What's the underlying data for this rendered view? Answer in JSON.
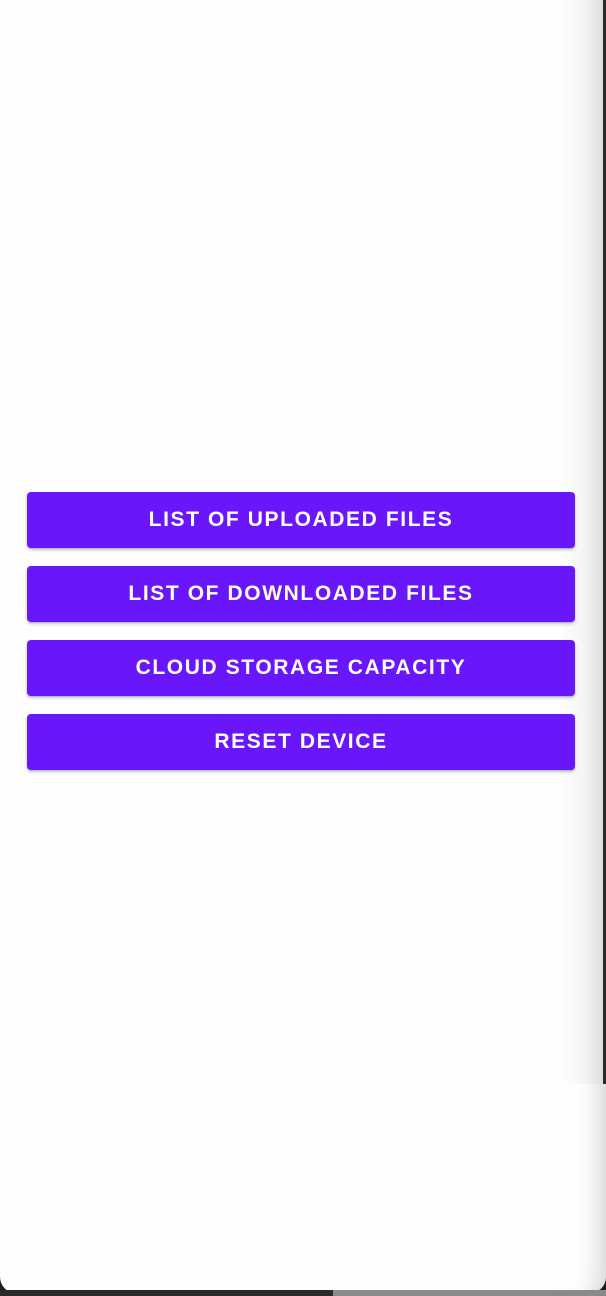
{
  "menu": {
    "buttons": [
      {
        "label": "LIST OF UPLOADED FILES"
      },
      {
        "label": "LIST OF DOWNLOADED FILES"
      },
      {
        "label": "CLOUD STORAGE CAPACITY"
      },
      {
        "label": "RESET DEVICE"
      }
    ]
  },
  "theme": {
    "button_color": "#6a16fb",
    "button_text_color": "#ffffff",
    "background_color": "#fefefe"
  }
}
